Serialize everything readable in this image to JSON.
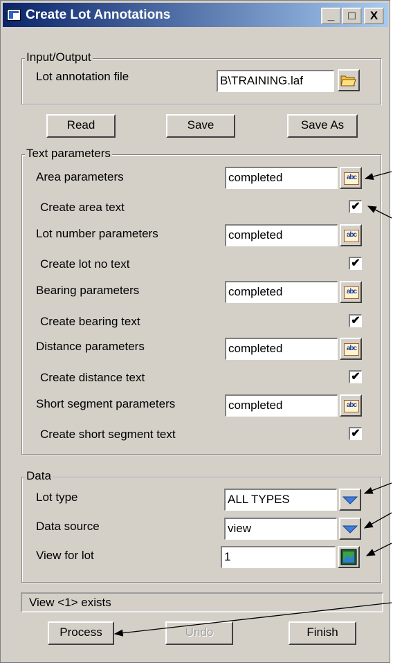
{
  "window": {
    "title": "Create Lot Annotations",
    "controls": {
      "minimize": "_",
      "maximize": "□",
      "close": "X"
    }
  },
  "input_output": {
    "legend": "Input/Output",
    "file_label": "Lot annotation file",
    "file_value": "B\\TRAINING.laf",
    "folder_icon": "folder-icon"
  },
  "file_buttons": {
    "read": "Read",
    "save": "Save",
    "save_as": "Save As"
  },
  "text_params": {
    "legend": "Text parameters",
    "rows": [
      {
        "label": "Area parameters",
        "value": "completed",
        "check_label": "Create area text",
        "checked": true
      },
      {
        "label": "Lot number parameters",
        "value": "completed",
        "check_label": "Create lot no text",
        "checked": true
      },
      {
        "label": "Bearing parameters",
        "value": "completed",
        "check_label": "Create bearing text",
        "checked": true
      },
      {
        "label": "Distance parameters",
        "value": "completed",
        "check_label": "Create distance text",
        "checked": true
      },
      {
        "label": "Short segment parameters",
        "value": "completed",
        "check_label": "Create short segment text",
        "checked": true
      }
    ],
    "check_glyph": "✔",
    "abc_text": "abc"
  },
  "data": {
    "legend": "Data",
    "lot_type_label": "Lot type",
    "lot_type_value": "ALL TYPES",
    "source_label": "Data source",
    "source_value": "view",
    "view_label": "View for lot",
    "view_value": "1"
  },
  "status": "View <1> exists",
  "actions": {
    "process": "Process",
    "undo": "Undo",
    "finish": "Finish"
  }
}
